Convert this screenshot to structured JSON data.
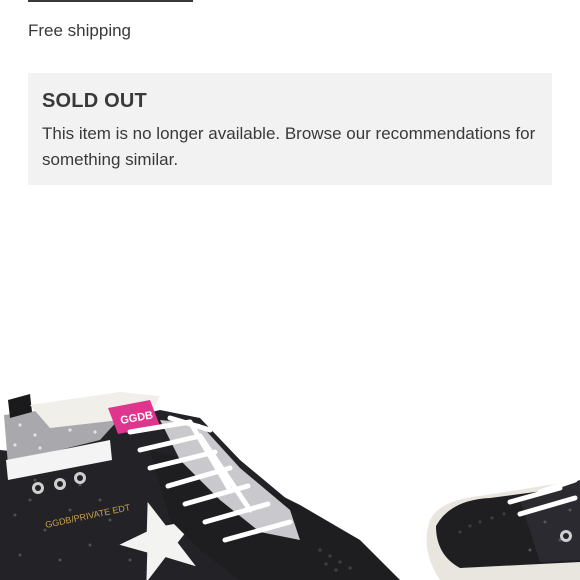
{
  "shipping": {
    "label": "Free shipping"
  },
  "availability": {
    "title": "SOLD OUT",
    "message": "This item is no longer available. Browse our recommendations for something similar."
  },
  "product_image": {
    "description_icon": "sneaker-photo",
    "tag_text": "GGDB",
    "insole_text": "GGDB/PRIVATE EDT"
  },
  "colors": {
    "text": "#393939",
    "panel": "#f2f2f2",
    "tag_pink": "#e0358f"
  }
}
